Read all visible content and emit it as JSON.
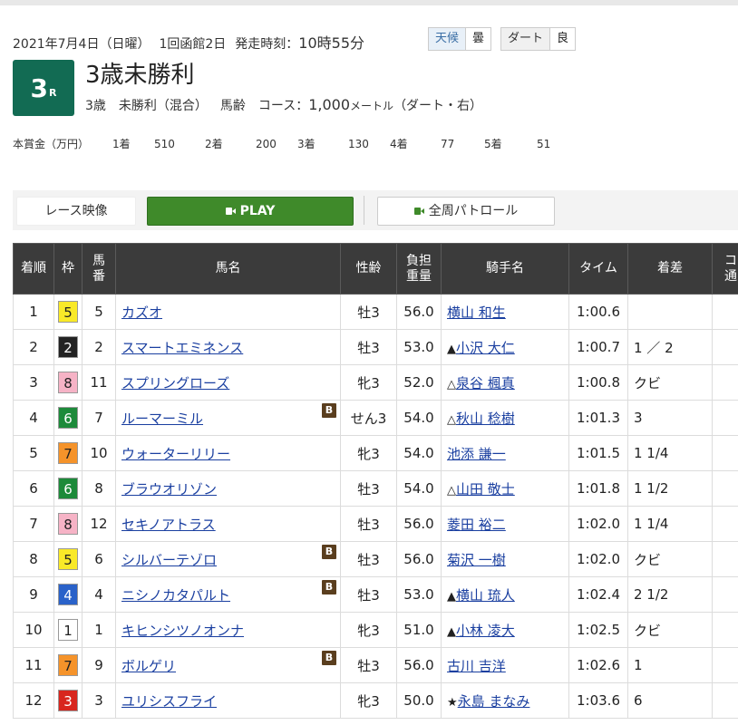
{
  "race": {
    "date": "2021年7月4日（日曜）",
    "meeting": "1回函館2日",
    "start_label": "発走時刻：",
    "start_time": "10時55分",
    "weather_label": "天候",
    "weather_value": "曇",
    "track_label": "ダート",
    "track_value": "良",
    "number": "3",
    "number_suffix": "R",
    "title": "3歳未勝利",
    "age": "3歳",
    "cls": "未勝利（混合）",
    "weight_rule": "馬齢",
    "course_label": "コース：",
    "distance": "1,000",
    "distance_unit": "メートル",
    "surface": "（ダート・右）"
  },
  "prize": {
    "label": "本賞金（万円）",
    "items": [
      {
        "place": "1着",
        "amount": "510"
      },
      {
        "place": "2着",
        "amount": "200"
      },
      {
        "place": "3着",
        "amount": "130"
      },
      {
        "place": "4着",
        "amount": "77"
      },
      {
        "place": "5着",
        "amount": "51"
      }
    ]
  },
  "buttons": {
    "video": "レース映像",
    "play": "PLAY",
    "patrol": "全周パトロール"
  },
  "table": {
    "headers": {
      "pos": "着順",
      "frame": "枠",
      "num_a": "馬",
      "num_b": "番",
      "horse": "馬名",
      "sexage": "性齢",
      "weight_a": "負担",
      "weight_b": "重量",
      "jockey": "騎手名",
      "time": "タイム",
      "margin": "着差",
      "extra_a": "コ",
      "extra_b": "通"
    },
    "blinker_label": "B",
    "frame_colors": {
      "1": {
        "bg": "#ffffff",
        "fg": "#222222"
      },
      "2": {
        "bg": "#222222",
        "fg": "#ffffff"
      },
      "3": {
        "bg": "#d8261e",
        "fg": "#ffffff"
      },
      "4": {
        "bg": "#2a62c9",
        "fg": "#ffffff"
      },
      "5": {
        "bg": "#f9e928",
        "fg": "#222222"
      },
      "6": {
        "bg": "#1d8a3a",
        "fg": "#ffffff"
      },
      "7": {
        "bg": "#f5932a",
        "fg": "#222222"
      },
      "8": {
        "bg": "#f6b3c6",
        "fg": "#222222"
      }
    },
    "rows": [
      {
        "pos": "1",
        "frame": "5",
        "num": "5",
        "horse": "カズオ",
        "blinker": false,
        "sexage": "牡3",
        "weight": "56.0",
        "mark": "",
        "jockey": "横山 和生",
        "time": "1:00.6",
        "margin": ""
      },
      {
        "pos": "2",
        "frame": "2",
        "num": "2",
        "horse": "スマートエミネンス",
        "blinker": false,
        "sexage": "牡3",
        "weight": "53.0",
        "mark": "▲",
        "jockey": "小沢 大仁",
        "time": "1:00.7",
        "margin": "1 ／ 2"
      },
      {
        "pos": "3",
        "frame": "8",
        "num": "11",
        "horse": "スプリングローズ",
        "blinker": false,
        "sexage": "牝3",
        "weight": "52.0",
        "mark": "△",
        "jockey": "泉谷 楓真",
        "time": "1:00.8",
        "margin": "クビ"
      },
      {
        "pos": "4",
        "frame": "6",
        "num": "7",
        "horse": "ルーマーミル",
        "blinker": true,
        "sexage": "せん3",
        "weight": "54.0",
        "mark": "△",
        "jockey": "秋山 稔樹",
        "time": "1:01.3",
        "margin": "3"
      },
      {
        "pos": "5",
        "frame": "7",
        "num": "10",
        "horse": "ウォーターリリー",
        "blinker": false,
        "sexage": "牝3",
        "weight": "54.0",
        "mark": "",
        "jockey": "池添 謙一",
        "time": "1:01.5",
        "margin": "1 1/4"
      },
      {
        "pos": "6",
        "frame": "6",
        "num": "8",
        "horse": "ブラウオリゾン",
        "blinker": false,
        "sexage": "牡3",
        "weight": "54.0",
        "mark": "△",
        "jockey": "山田 敬士",
        "time": "1:01.8",
        "margin": "1 1/2"
      },
      {
        "pos": "7",
        "frame": "8",
        "num": "12",
        "horse": "セキノアトラス",
        "blinker": false,
        "sexage": "牡3",
        "weight": "56.0",
        "mark": "",
        "jockey": "菱田 裕二",
        "time": "1:02.0",
        "margin": "1 1/4"
      },
      {
        "pos": "8",
        "frame": "5",
        "num": "6",
        "horse": "シルバーテゾロ",
        "blinker": true,
        "sexage": "牡3",
        "weight": "56.0",
        "mark": "",
        "jockey": "菊沢 一樹",
        "time": "1:02.0",
        "margin": "クビ"
      },
      {
        "pos": "9",
        "frame": "4",
        "num": "4",
        "horse": "ニシノカタパルト",
        "blinker": true,
        "sexage": "牡3",
        "weight": "53.0",
        "mark": "▲",
        "jockey": "横山 琉人",
        "time": "1:02.4",
        "margin": "2 1/2"
      },
      {
        "pos": "10",
        "frame": "1",
        "num": "1",
        "horse": "キヒンシツノオンナ",
        "blinker": false,
        "sexage": "牝3",
        "weight": "51.0",
        "mark": "▲",
        "jockey": "小林 凌大",
        "time": "1:02.5",
        "margin": "クビ"
      },
      {
        "pos": "11",
        "frame": "7",
        "num": "9",
        "horse": "ボルゲリ",
        "blinker": true,
        "sexage": "牡3",
        "weight": "56.0",
        "mark": "",
        "jockey": "古川 吉洋",
        "time": "1:02.6",
        "margin": "1"
      },
      {
        "pos": "12",
        "frame": "3",
        "num": "3",
        "horse": "ユリシスフライ",
        "blinker": false,
        "sexage": "牝3",
        "weight": "50.0",
        "mark": "★",
        "jockey": "永島 まなみ",
        "time": "1:03.6",
        "margin": "6"
      }
    ]
  }
}
